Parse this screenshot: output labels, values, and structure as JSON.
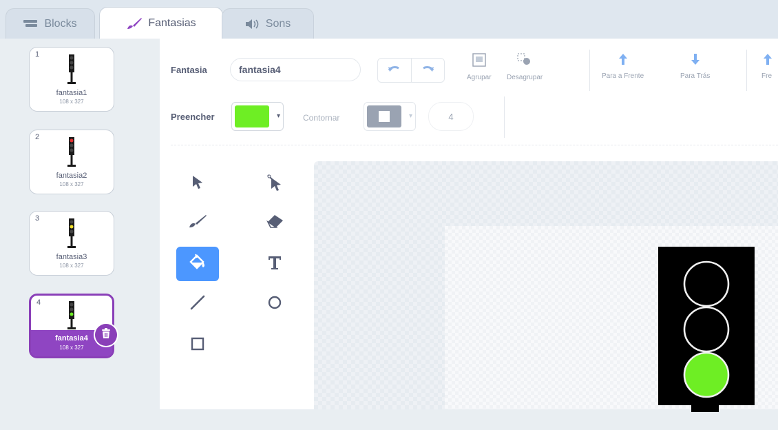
{
  "tabs": [
    {
      "label": "Blocks",
      "icon": "blocks-icon"
    },
    {
      "label": "Fantasias",
      "icon": "brush-icon",
      "active": true
    },
    {
      "label": "Sons",
      "icon": "speaker-icon"
    }
  ],
  "costumes": [
    {
      "number": "1",
      "name": "fantasia1",
      "size": "108 x 327",
      "light": "none"
    },
    {
      "number": "2",
      "name": "fantasia2",
      "size": "108 x 327",
      "light": "red"
    },
    {
      "number": "3",
      "name": "fantasia3",
      "size": "108 x 327",
      "light": "yellow"
    },
    {
      "number": "4",
      "name": "fantasia4",
      "size": "108 x 327",
      "light": "green",
      "selected": true
    }
  ],
  "editor": {
    "costume_label": "Fantasia",
    "costume_name": "fantasia4",
    "group_label": "Agrupar",
    "ungroup_label": "Desagrupar",
    "forward_label": "Para a Frente",
    "backward_label": "Para Trás",
    "front_label": "Fre",
    "fill_label": "Preencher",
    "outline_label": "Contornar",
    "outline_width": "4"
  },
  "colors": {
    "fill": "#6eee24",
    "outline": "#ffffff",
    "accent": "#8f45c2",
    "tool_active": "#4c97ff",
    "light_on": "#6eee24"
  }
}
